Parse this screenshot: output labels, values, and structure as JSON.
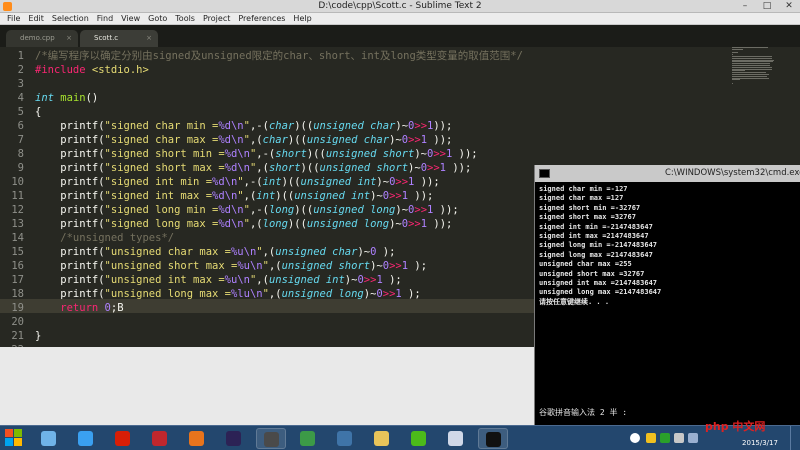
{
  "sublime": {
    "title": "D:\\code\\cpp\\Scott.c - Sublime Text 2",
    "menu": [
      "File",
      "Edit",
      "Selection",
      "Find",
      "View",
      "Goto",
      "Tools",
      "Project",
      "Preferences",
      "Help"
    ],
    "tabs": [
      {
        "label": "demo.cpp",
        "close": "×"
      },
      {
        "label": "Scott.c",
        "close": "×"
      }
    ],
    "line_numbers": [
      "1",
      "2",
      "3",
      "4",
      "5",
      "6",
      "7",
      "8",
      "9",
      "10",
      "11",
      "12",
      "13",
      "14",
      "15",
      "16",
      "17",
      "18",
      "19",
      "20",
      "21",
      "22"
    ],
    "code": [
      [
        {
          "t": "c",
          "v": "/*编写程序以确定分别由signed及unsigned限定的char、short、int及long类型变量的取值范围*/"
        }
      ],
      [
        {
          "t": "pp",
          "v": "#include"
        },
        {
          "t": "p",
          "v": " "
        },
        {
          "t": "s",
          "v": "<stdio.h>"
        }
      ],
      [],
      [
        {
          "t": "f",
          "v": "int"
        },
        {
          "t": "p",
          "v": " "
        },
        {
          "t": "fn",
          "v": "main"
        },
        {
          "t": "p",
          "v": "()"
        }
      ],
      [
        {
          "t": "p",
          "v": "{"
        }
      ],
      [
        {
          "t": "p",
          "v": "    printf("
        },
        {
          "t": "s",
          "v": "\"signed char min ="
        },
        {
          "t": "n",
          "v": "%d\\n"
        },
        {
          "t": "s",
          "v": "\""
        },
        {
          "t": "p",
          "v": ",-("
        },
        {
          "t": "f",
          "v": "char"
        },
        {
          "t": "p",
          "v": ")(("
        },
        {
          "t": "f",
          "v": "unsigned char"
        },
        {
          "t": "p",
          "v": ")~"
        },
        {
          "t": "n",
          "v": "0"
        },
        {
          "t": "k",
          "v": ">>"
        },
        {
          "t": "n",
          "v": "1"
        },
        {
          "t": "p",
          "v": "));"
        }
      ],
      [
        {
          "t": "p",
          "v": "    printf("
        },
        {
          "t": "s",
          "v": "\"signed char max ="
        },
        {
          "t": "n",
          "v": "%d\\n"
        },
        {
          "t": "s",
          "v": "\""
        },
        {
          "t": "p",
          "v": ",("
        },
        {
          "t": "f",
          "v": "char"
        },
        {
          "t": "p",
          "v": ")(("
        },
        {
          "t": "f",
          "v": "unsigned char"
        },
        {
          "t": "p",
          "v": ")~"
        },
        {
          "t": "n",
          "v": "0"
        },
        {
          "t": "k",
          "v": ">>"
        },
        {
          "t": "n",
          "v": "1"
        },
        {
          "t": "p",
          "v": " ));"
        }
      ],
      [
        {
          "t": "p",
          "v": "    printf("
        },
        {
          "t": "s",
          "v": "\"signed short min ="
        },
        {
          "t": "n",
          "v": "%d\\n"
        },
        {
          "t": "s",
          "v": "\""
        },
        {
          "t": "p",
          "v": ",-("
        },
        {
          "t": "f",
          "v": "short"
        },
        {
          "t": "p",
          "v": ")(("
        },
        {
          "t": "f",
          "v": "unsigned short"
        },
        {
          "t": "p",
          "v": ")~"
        },
        {
          "t": "n",
          "v": "0"
        },
        {
          "t": "k",
          "v": ">>"
        },
        {
          "t": "n",
          "v": "1"
        },
        {
          "t": "p",
          "v": " ));"
        }
      ],
      [
        {
          "t": "p",
          "v": "    printf("
        },
        {
          "t": "s",
          "v": "\"signed short max ="
        },
        {
          "t": "n",
          "v": "%d\\n"
        },
        {
          "t": "s",
          "v": "\""
        },
        {
          "t": "p",
          "v": ",("
        },
        {
          "t": "f",
          "v": "short"
        },
        {
          "t": "p",
          "v": ")(("
        },
        {
          "t": "f",
          "v": "unsigned short"
        },
        {
          "t": "p",
          "v": ")~"
        },
        {
          "t": "n",
          "v": "0"
        },
        {
          "t": "k",
          "v": ">>"
        },
        {
          "t": "n",
          "v": "1"
        },
        {
          "t": "p",
          "v": " ));"
        }
      ],
      [
        {
          "t": "p",
          "v": "    printf("
        },
        {
          "t": "s",
          "v": "\"signed int min ="
        },
        {
          "t": "n",
          "v": "%d\\n"
        },
        {
          "t": "s",
          "v": "\""
        },
        {
          "t": "p",
          "v": ",-("
        },
        {
          "t": "f",
          "v": "int"
        },
        {
          "t": "p",
          "v": ")(("
        },
        {
          "t": "f",
          "v": "unsigned int"
        },
        {
          "t": "p",
          "v": ")~"
        },
        {
          "t": "n",
          "v": "0"
        },
        {
          "t": "k",
          "v": ">>"
        },
        {
          "t": "n",
          "v": "1"
        },
        {
          "t": "p",
          "v": " ));"
        }
      ],
      [
        {
          "t": "p",
          "v": "    printf("
        },
        {
          "t": "s",
          "v": "\"signed int max ="
        },
        {
          "t": "n",
          "v": "%d\\n"
        },
        {
          "t": "s",
          "v": "\""
        },
        {
          "t": "p",
          "v": ",("
        },
        {
          "t": "f",
          "v": "int"
        },
        {
          "t": "p",
          "v": ")(("
        },
        {
          "t": "f",
          "v": "unsigned int"
        },
        {
          "t": "p",
          "v": ")~"
        },
        {
          "t": "n",
          "v": "0"
        },
        {
          "t": "k",
          "v": ">>"
        },
        {
          "t": "n",
          "v": "1"
        },
        {
          "t": "p",
          "v": " ));"
        }
      ],
      [
        {
          "t": "p",
          "v": "    printf("
        },
        {
          "t": "s",
          "v": "\"signed long min ="
        },
        {
          "t": "n",
          "v": "%d\\n"
        },
        {
          "t": "s",
          "v": "\""
        },
        {
          "t": "p",
          "v": ",-("
        },
        {
          "t": "f",
          "v": "long"
        },
        {
          "t": "p",
          "v": ")(("
        },
        {
          "t": "f",
          "v": "unsigned long"
        },
        {
          "t": "p",
          "v": ")~"
        },
        {
          "t": "n",
          "v": "0"
        },
        {
          "t": "k",
          "v": ">>"
        },
        {
          "t": "n",
          "v": "1"
        },
        {
          "t": "p",
          "v": " ));"
        }
      ],
      [
        {
          "t": "p",
          "v": "    printf("
        },
        {
          "t": "s",
          "v": "\"signed long max ="
        },
        {
          "t": "n",
          "v": "%d\\n"
        },
        {
          "t": "s",
          "v": "\""
        },
        {
          "t": "p",
          "v": ",("
        },
        {
          "t": "f",
          "v": "long"
        },
        {
          "t": "p",
          "v": ")(("
        },
        {
          "t": "f",
          "v": "unsigned long"
        },
        {
          "t": "p",
          "v": ")~"
        },
        {
          "t": "n",
          "v": "0"
        },
        {
          "t": "k",
          "v": ">>"
        },
        {
          "t": "n",
          "v": "1"
        },
        {
          "t": "p",
          "v": " ));"
        }
      ],
      [
        {
          "t": "c",
          "v": "    /*unsigned types*/"
        }
      ],
      [
        {
          "t": "p",
          "v": "    printf("
        },
        {
          "t": "s",
          "v": "\"unsigned char max ="
        },
        {
          "t": "n",
          "v": "%u\\n"
        },
        {
          "t": "s",
          "v": "\""
        },
        {
          "t": "p",
          "v": ",("
        },
        {
          "t": "f",
          "v": "unsigned char"
        },
        {
          "t": "p",
          "v": ")~"
        },
        {
          "t": "n",
          "v": "0"
        },
        {
          "t": "p",
          "v": " );"
        }
      ],
      [
        {
          "t": "p",
          "v": "    printf("
        },
        {
          "t": "s",
          "v": "\"unsigned short max ="
        },
        {
          "t": "n",
          "v": "%u\\n"
        },
        {
          "t": "s",
          "v": "\""
        },
        {
          "t": "p",
          "v": ",("
        },
        {
          "t": "f",
          "v": "unsigned short"
        },
        {
          "t": "p",
          "v": ")~"
        },
        {
          "t": "n",
          "v": "0"
        },
        {
          "t": "k",
          "v": ">>"
        },
        {
          "t": "n",
          "v": "1"
        },
        {
          "t": "p",
          "v": " );"
        }
      ],
      [
        {
          "t": "p",
          "v": "    printf("
        },
        {
          "t": "s",
          "v": "\"unsigned int max ="
        },
        {
          "t": "n",
          "v": "%u\\n"
        },
        {
          "t": "s",
          "v": "\""
        },
        {
          "t": "p",
          "v": ",("
        },
        {
          "t": "f",
          "v": "unsigned int"
        },
        {
          "t": "p",
          "v": ")~"
        },
        {
          "t": "n",
          "v": "0"
        },
        {
          "t": "k",
          "v": ">>"
        },
        {
          "t": "n",
          "v": "1"
        },
        {
          "t": "p",
          "v": " );"
        }
      ],
      [
        {
          "t": "p",
          "v": "    printf("
        },
        {
          "t": "s",
          "v": "\"unsigned long max ="
        },
        {
          "t": "n",
          "v": "%lu\\n"
        },
        {
          "t": "s",
          "v": "\""
        },
        {
          "t": "p",
          "v": ",("
        },
        {
          "t": "f",
          "v": "unsigned long"
        },
        {
          "t": "p",
          "v": ")~"
        },
        {
          "t": "n",
          "v": "0"
        },
        {
          "t": "k",
          "v": ">>"
        },
        {
          "t": "n",
          "v": "1"
        },
        {
          "t": "p",
          "v": " );"
        }
      ],
      [
        {
          "t": "k",
          "v": "    return"
        },
        {
          "t": "p",
          "v": " "
        },
        {
          "t": "n",
          "v": "0"
        },
        {
          "t": "p",
          "v": ";B"
        }
      ],
      [],
      [
        {
          "t": "p",
          "v": "}"
        }
      ],
      []
    ],
    "syntax_colors": {
      "bg": "#272822",
      "comment": "#75715e",
      "keyword": "#f92672",
      "string": "#e6db74",
      "type": "#66d9ef",
      "function": "#a6e22e",
      "number": "#ae81ff"
    }
  },
  "cmd": {
    "title": "C:\\WINDOWS\\system32\\cmd.exe",
    "output": [
      "signed char min =-127",
      "signed char max =127",
      "signed short min =-32767",
      "signed short max =32767",
      "signed int min =-2147483647",
      "signed int max =2147483647",
      "signed long min =-2147483647",
      "signed long max =2147483647",
      "unsigned char max =255",
      "unsigned short max =32767",
      "unsigned int max =2147483647",
      "unsigned long max =2147483647",
      "请按任意键继续. . ."
    ],
    "ime_status": "谷歌拼音输入法 2 半 :"
  },
  "taskbar": {
    "apps": [
      {
        "name": "control-panel-icon",
        "color": "#6fb3e8",
        "open": false
      },
      {
        "name": "feather-app-icon",
        "color": "#3aa0f0",
        "open": false
      },
      {
        "name": "netease-music-icon",
        "color": "#d81e06",
        "open": false
      },
      {
        "name": "filezilla-icon",
        "color": "#c0272d",
        "open": false
      },
      {
        "name": "firefox-icon",
        "color": "#e8741c",
        "open": false
      },
      {
        "name": "eclipse-icon",
        "color": "#2c2255",
        "open": false
      },
      {
        "name": "sublime-text-icon",
        "color": "#4a4a4a",
        "open": true
      },
      {
        "name": "chrome-icon",
        "color": "#3c9a47",
        "open": false
      },
      {
        "name": "python-icon",
        "color": "#3f74a8",
        "open": false
      },
      {
        "name": "folder-icon",
        "color": "#e8c45a",
        "open": false
      },
      {
        "name": "green-plus-app-icon",
        "color": "#4cbb1a",
        "open": false
      },
      {
        "name": "image-viewer-icon",
        "color": "#d0d8e8",
        "open": false
      },
      {
        "name": "cmd-icon",
        "color": "#111111",
        "open": true
      }
    ],
    "date": "2015/3/17",
    "watermark": "php 中文网"
  }
}
